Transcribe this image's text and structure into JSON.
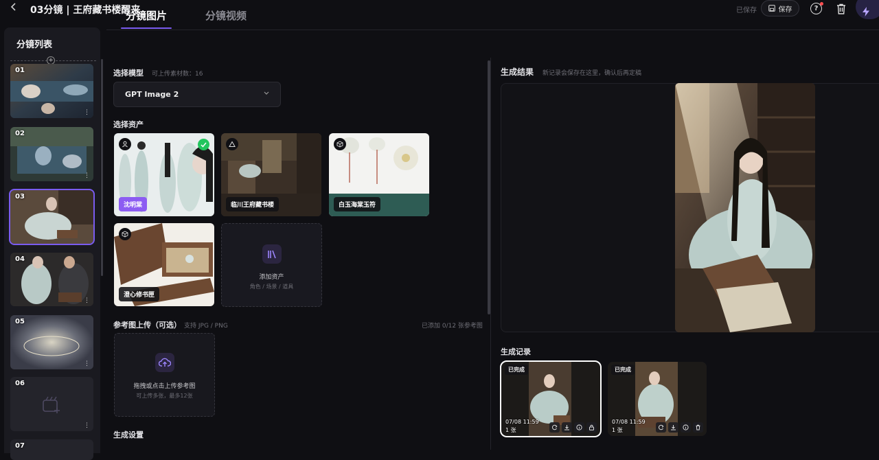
{
  "header": {
    "back_icon": "chevron-left-icon",
    "title": "03分镜 | 王府藏书楼醒来",
    "saved_status": "已保存",
    "save_label": "保存"
  },
  "sidebar": {
    "title": "分镜列表",
    "shots": [
      {
        "num": "01"
      },
      {
        "num": "02"
      },
      {
        "num": "03",
        "selected": true
      },
      {
        "num": "04"
      },
      {
        "num": "05"
      },
      {
        "num": "06",
        "empty": true
      },
      {
        "num": "07"
      }
    ]
  },
  "tabs": [
    {
      "label": "分镜图片",
      "active": true
    },
    {
      "label": "分镜视频",
      "active": false
    }
  ],
  "model": {
    "label": "选择模型",
    "hint": "可上传素材数：16",
    "selected": "GPT Image 2"
  },
  "assets": {
    "label": "选择资产",
    "items": [
      {
        "name": "沈明棠",
        "icon": "person-icon"
      },
      {
        "name": "临川王府藏书楼",
        "icon": "mountain-icon"
      },
      {
        "name": "白玉海棠玉符",
        "icon": "cube-icon"
      },
      {
        "name": "澄心修书匣",
        "icon": "cube-icon"
      }
    ],
    "add_label": "添加资产",
    "add_sub": "角色 / 场景 / 道具"
  },
  "reference": {
    "label": "参考图上传（可选）",
    "hint": "支持 JPG / PNG",
    "count": "已添加 0/12 张参考图",
    "upload_label": "拖拽或点击上传参考图",
    "upload_sub": "可上传多张，最多12张"
  },
  "settings": {
    "label": "生成设置"
  },
  "result": {
    "label": "生成结果",
    "hint": "新记录会保存在这里，确认后再定稿"
  },
  "history": {
    "label": "生成记录",
    "items": [
      {
        "status": "已完成",
        "time": "07/08 11:59",
        "count": "1 张",
        "selected": true
      },
      {
        "status": "已完成",
        "time": "07/08 11:59",
        "count": "1 张",
        "selected": false
      }
    ]
  },
  "colors": {
    "accent": "#7a5cf0",
    "bg": "#0f0f13",
    "panel": "#1a1a20"
  }
}
